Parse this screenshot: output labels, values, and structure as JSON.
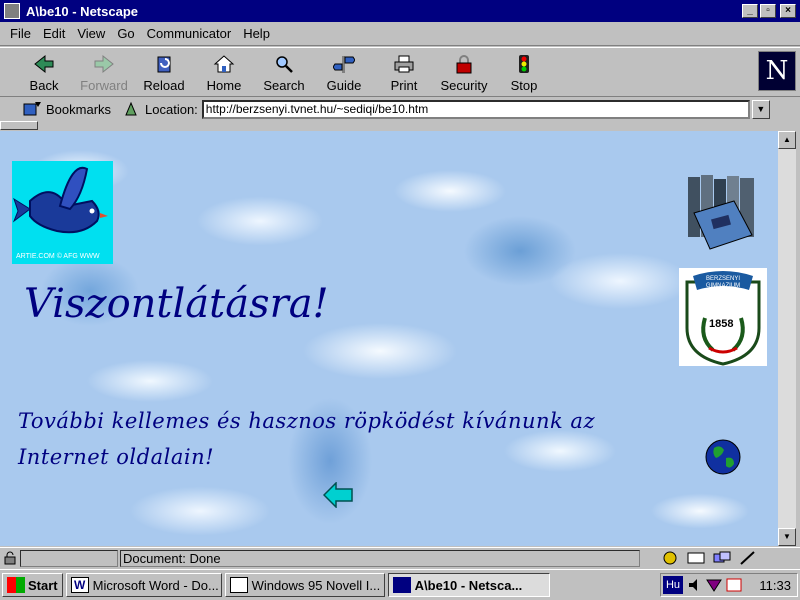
{
  "window": {
    "title": "A\\be10 - Netscape",
    "minimize": "_",
    "restore": "▫",
    "close": "×"
  },
  "menu": [
    "File",
    "Edit",
    "View",
    "Go",
    "Communicator",
    "Help"
  ],
  "toolbar": {
    "buttons": [
      {
        "label": "Back",
        "icon": "back-arrow-icon"
      },
      {
        "label": "Forward",
        "icon": "forward-arrow-icon",
        "disabled": true
      },
      {
        "label": "Reload",
        "icon": "reload-icon"
      },
      {
        "label": "Home",
        "icon": "home-icon"
      },
      {
        "label": "Search",
        "icon": "search-icon"
      },
      {
        "label": "Guide",
        "icon": "guide-icon"
      },
      {
        "label": "Print",
        "icon": "print-icon"
      },
      {
        "label": "Security",
        "icon": "security-lock-icon"
      },
      {
        "label": "Stop",
        "icon": "stop-icon"
      }
    ],
    "logo": "N"
  },
  "location": {
    "bookmarks_label": "Bookmarks",
    "location_label": "Location:",
    "url": "http://berzsenyi.tvnet.hu/~sediqi/be10.htm"
  },
  "page": {
    "bird_caption": "ARTIE.COM  © AFG  WWW",
    "heading": "Viszontlátásra!",
    "message": "További kellemes és hasznos röpködést kívánunk az Internet oldalain!",
    "crest_top": "BERZSENYI GIMNAZIUM",
    "crest_year": "1858",
    "colors": {
      "heading": "#000080",
      "background": "#a9c9ee"
    }
  },
  "statusbar": {
    "text": "Document: Done"
  },
  "taskbar": {
    "start": "Start",
    "tasks": [
      {
        "label": "Microsoft Word - Do...",
        "active": false
      },
      {
        "label": "Windows 95 Novell I...",
        "active": false
      },
      {
        "label": "A\\be10 - Netsca...",
        "active": true
      }
    ],
    "lang": "Hu",
    "clock": "11:33"
  }
}
